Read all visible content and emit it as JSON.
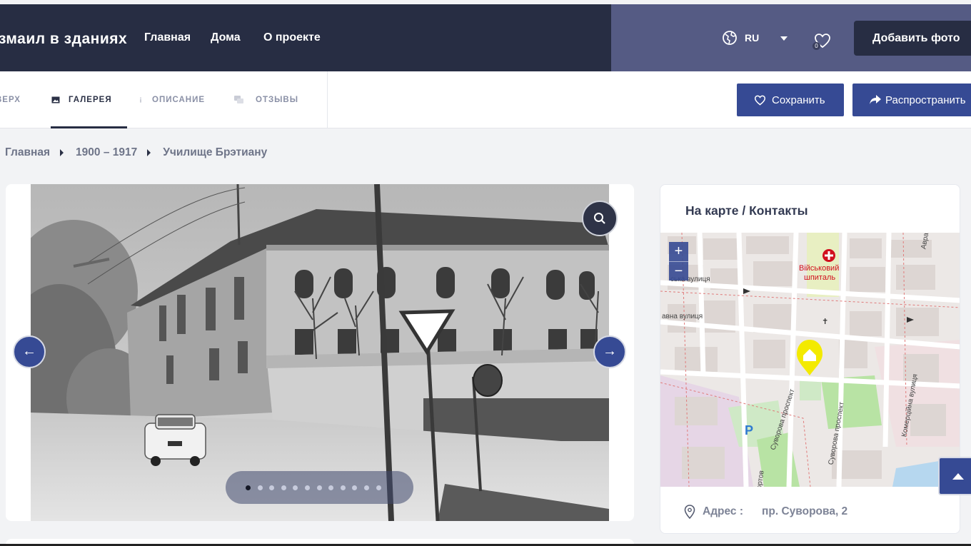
{
  "header": {
    "brand": "змаил в зданиях",
    "nav": [
      "Главная",
      "Дома",
      "О проекте"
    ],
    "language": "RU",
    "favorites_count": "0",
    "add_photo": "Добавить фото"
  },
  "subnav": {
    "tabs": [
      {
        "label": "ВЕРХ",
        "icon": "arrow-up-icon"
      },
      {
        "label": "ГАЛЕРЕЯ",
        "icon": "image-icon",
        "active": true
      },
      {
        "label": "ОПИСАНИЕ",
        "icon": "info-icon"
      },
      {
        "label": "ОТЗЫВЫ",
        "icon": "comments-icon"
      }
    ],
    "save": "Сохранить",
    "share": "Распространить"
  },
  "breadcrumb": [
    "Главная",
    "1900 – 1917",
    "Училище Брэтиану"
  ],
  "gallery": {
    "slide_count": 12,
    "active_slide": 1
  },
  "map_card": {
    "title": "На карте / Контакты",
    "address_label": "Адрес :",
    "address_value": "пр. Суворова, 2",
    "map_labels": {
      "hospital": "Військовий",
      "hospital2": "шпиталь",
      "street1": "ська вулиця",
      "street2": "авна вулиця",
      "street3": "Суворова проспект",
      "street4": "Суворова проспект",
      "street5": "Комерційна вулиця",
      "street6": "Авра",
      "street7": "Портов",
      "parking": "P"
    },
    "colors": {
      "marker": "#f3ea00",
      "hospital": "#d10f1e",
      "green": "#b8e3a4"
    }
  },
  "colors": {
    "header_dark": "#272d43",
    "header_light": "#555b84",
    "accent": "#364a94"
  }
}
